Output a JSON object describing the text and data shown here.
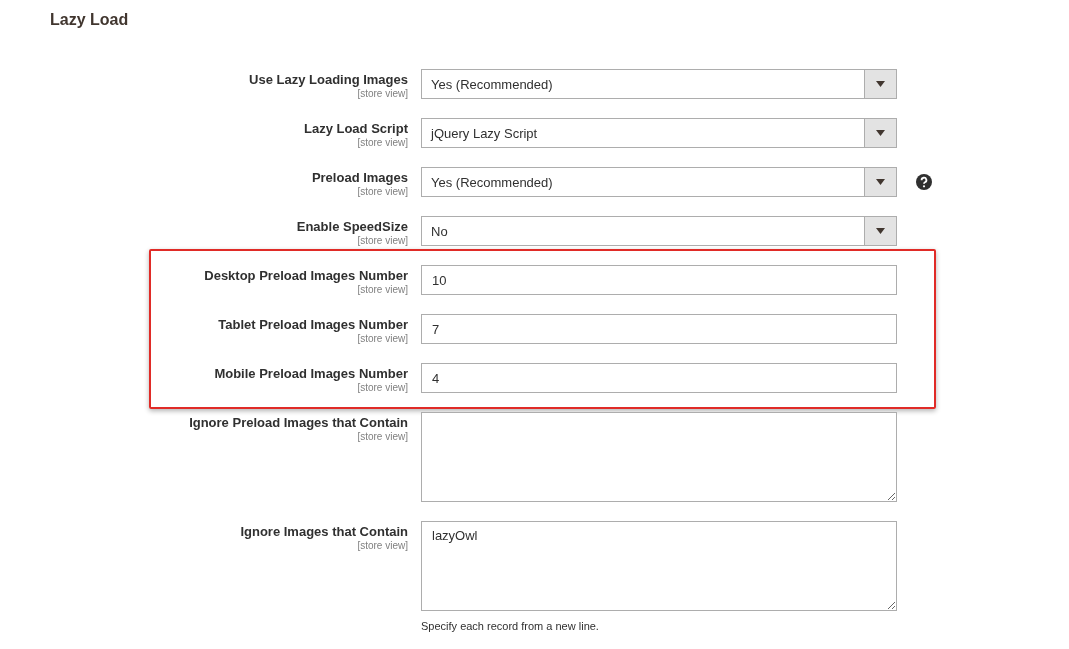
{
  "section_title": "Lazy Load",
  "groups": [
    {
      "highlighted": false,
      "fields": [
        {
          "kind": "select",
          "label": "Use Lazy Loading Images",
          "scope": "[store view]",
          "value": "Yes (Recommended)",
          "help": false
        },
        {
          "kind": "select",
          "label": "Lazy Load Script",
          "scope": "[store view]",
          "value": "jQuery Lazy Script",
          "help": false
        },
        {
          "kind": "select",
          "label": "Preload Images",
          "scope": "[store view]",
          "value": "Yes (Recommended)",
          "help": true
        },
        {
          "kind": "select",
          "label": "Enable SpeedSize",
          "scope": "[store view]",
          "value": "No",
          "help": false
        }
      ]
    },
    {
      "highlighted": true,
      "fields": [
        {
          "kind": "text",
          "label": "Desktop Preload Images Number",
          "scope": "[store view]",
          "value": "10",
          "help": false
        },
        {
          "kind": "text",
          "label": "Tablet Preload Images Number",
          "scope": "[store view]",
          "value": "7",
          "help": false
        },
        {
          "kind": "text",
          "label": "Mobile Preload Images Number",
          "scope": "[store view]",
          "value": "4",
          "help": false
        }
      ]
    },
    {
      "highlighted": false,
      "fields": [
        {
          "kind": "textarea",
          "label": "Ignore Preload Images that Contain",
          "scope": "[store view]",
          "help": false
        },
        {
          "kind": "textarea",
          "label": "Ignore Images that Contain",
          "scope": "[store view]",
          "value": "lazyOwl",
          "help": false,
          "note": "Specify each record from a new line."
        }
      ]
    }
  ]
}
